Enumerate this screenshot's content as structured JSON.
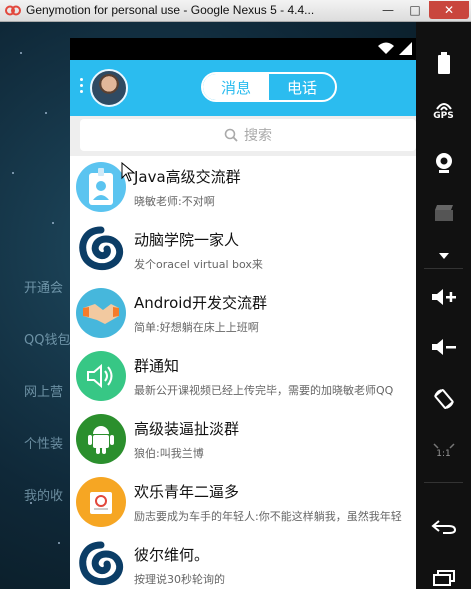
{
  "window": {
    "title": "Genymotion for personal use - Google Nexus 5 - 4.4..."
  },
  "desktop_menu": [
    "开通会",
    "QQ钱包",
    "网上营",
    "个性装",
    "我的收"
  ],
  "app": {
    "tabs": [
      {
        "label": "消息",
        "active": true
      },
      {
        "label": "电话",
        "active": false
      }
    ],
    "search_placeholder": "搜索",
    "conversations": [
      {
        "name": "Java高级交流群",
        "message": "晓敏老师:不对啊",
        "icon": "id-badge-icon",
        "color": "#5bc4f0"
      },
      {
        "name": "动脑学院一家人",
        "message": "发个oracel virtual box来",
        "icon": "swirl-logo-icon",
        "color": "#0b3d66"
      },
      {
        "name": "Android开发交流群",
        "message": "简单:好想躺在床上上班啊",
        "icon": "handshake-icon",
        "color": "#46b7dc"
      },
      {
        "name": "群通知",
        "message": "最新公开课视频已经上传完毕，需要的加晓敏老师QQ",
        "icon": "speaker-icon",
        "color": "#37c785"
      },
      {
        "name": "高级装逼扯淡群",
        "message": "狼伯:叫我兰博",
        "icon": "android-robot-icon",
        "color": "#2b8f2d"
      },
      {
        "name": "欢乐青年二逼多",
        "message": "励志要成为车手的年轻人:你不能这样躺我，虽然我年轻",
        "icon": "notepad-icon",
        "color": "#f6a623"
      },
      {
        "name": "彼尔维何。",
        "message": "按理说30秒轮询的",
        "icon": "swirl-logo-icon",
        "color": "#0b3d66"
      }
    ]
  },
  "toolbar": {
    "gps_label": "GPS",
    "scale_label": "1:1",
    "icons": [
      "battery-icon",
      "gps-icon",
      "webcam-icon",
      "video-clapper-icon",
      "dropdown-icon",
      "volume-up-icon",
      "volume-down-icon",
      "rotate-icon",
      "scale-icon",
      "back-icon",
      "recent-apps-icon"
    ]
  }
}
